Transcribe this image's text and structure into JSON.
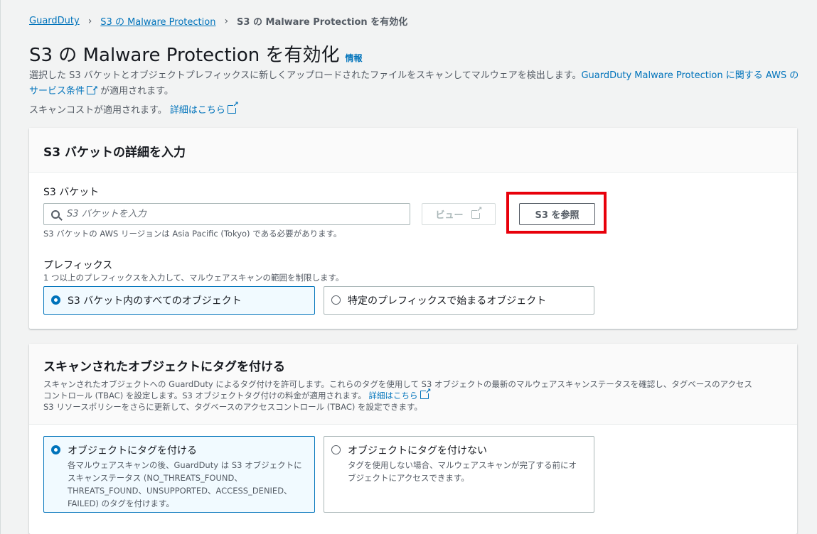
{
  "breadcrumb": {
    "item1": "GuardDuty",
    "item2": "S3 の Malware Protection",
    "current": "S3 の Malware Protection を有効化"
  },
  "page": {
    "title": "S3 の Malware Protection を有効化",
    "info_link": "情報",
    "description_part1": "選択した S3 バケットとオブジェクトプレフィックスに新しくアップロードされたファイルをスキャンしてマルウェアを検出します。",
    "description_link": "GuardDuty Malware Protection に関する AWS のサービス条件",
    "description_part2": " が適用されます。",
    "cost_text": "スキャンコストが適用されます。",
    "cost_link": "詳細はこちら"
  },
  "bucket_section": {
    "title": "S3 バケットの詳細を入力",
    "bucket_label": "S3 バケット",
    "search_placeholder": "S3 バケットを入力",
    "view_button": "ビュー",
    "browse_button": "S3 を参照",
    "region_hint": "S3 バケットの AWS リージョンは Asia Pacific (Tokyo) である必要があります。",
    "prefix_label": "プレフィックス",
    "prefix_hint": "1 つ以上のプレフィックスを入力して、マルウェアスキャンの範囲を制限します。",
    "option_all": "S3 バケット内のすべてのオブジェクト",
    "option_prefix": "特定のプレフィックスで始まるオブジェクト"
  },
  "tag_section": {
    "title": "スキャンされたオブジェクトにタグを付ける",
    "desc_line1": "スキャンされたオブジェクトへの GuardDuty によるタグ付けを許可します。これらのタグを使用して S3 オブジェクトの最新のマルウェアスキャンステータスを確認し、タグベースのアクセス",
    "desc_line2": "コントロール (TBAC) を設定します。S3 オブジェクトタグ付けの料金が適用されます。",
    "desc_link": "詳細はこちら",
    "desc_line3": "S3 リソースポリシーをさらに更新して、タグベースのアクセスコントロール (TBAC) を設定できます。",
    "option_tag_title": "オブジェクトにタグを付ける",
    "option_tag_desc": "各マルウェアスキャンの後、GuardDuty は S3 オブジェクトにスキャンステータス (NO_THREATS_FOUND、THREATS_FOUND、UNSUPPORTED、ACCESS_DENIED、FAILED) のタグを付けます。",
    "option_notag_title": "オブジェクトにタグを付けない",
    "option_notag_desc": "タグを使用しない場合、マルウェアスキャンが完了する前にオブジェクトにアクセスできます。"
  },
  "colors": {
    "link": "#0073bb",
    "highlight": "#e8000b"
  }
}
